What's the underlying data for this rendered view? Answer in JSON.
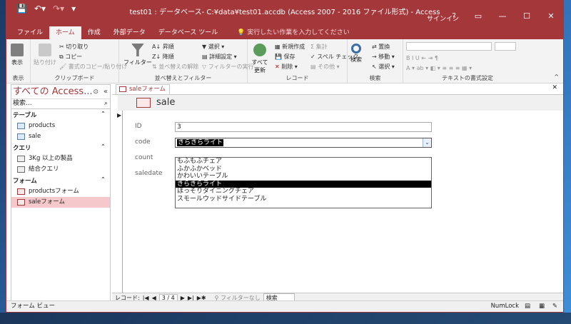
{
  "window": {
    "title": "test01 : データベース- C:¥data¥test01.accdb (Access 2007 - 2016 ファイル形式) - Access",
    "signin": "サインイン",
    "help": "?"
  },
  "tabs": [
    "ファイル",
    "ホーム",
    "作成",
    "外部データ",
    "データベース ツール"
  ],
  "tell_me": "実行したい作業を入力してください",
  "ribbon": {
    "view": "表示",
    "view_group": "表示",
    "paste": "貼り付け",
    "cut": "切り取り",
    "copy": "コピー",
    "format_painter": "書式のコピー/貼り付け",
    "clipboard_group": "クリップボード",
    "filter": "フィルター",
    "ascending": "昇順",
    "descending": "降順",
    "remove_sort": "並べ替えの解除",
    "selection": "選択",
    "advanced": "詳細設定",
    "toggle_filter": "フィルターの実行",
    "sort_filter_group": "並べ替えとフィルター",
    "refresh_all": "すべて更新",
    "new": "新規作成",
    "save": "保存",
    "delete": "削除",
    "totals": "集計",
    "spelling": "スペル チェック",
    "more": "その他",
    "records_group": "レコード",
    "find": "検索",
    "replace": "置換",
    "goto": "移動",
    "select": "選択",
    "find_group": "検索",
    "text_format_group": "テキストの書式設定"
  },
  "nav": {
    "header": "すべての Access...",
    "search_placeholder": "検索...",
    "sections": [
      {
        "title": "テーブル",
        "items": [
          "products",
          "sale"
        ]
      },
      {
        "title": "クエリ",
        "items": [
          "3Kg 以上の製品",
          "結合クエリ"
        ]
      },
      {
        "title": "フォーム",
        "items": [
          "productsフォーム",
          "saleフォーム"
        ]
      }
    ]
  },
  "document": {
    "tab_label": "saleフォーム",
    "form_title": "sale",
    "labels": {
      "id": "ID",
      "code": "code",
      "count": "count",
      "saledate": "saledate"
    },
    "id_value": "3",
    "code_value": "きらきらライト",
    "dropdown_options": [
      "もふもふチェア",
      "ふかふかベッド",
      "かわいいテーブル",
      "きらきらライト",
      "ほっそりダイニングチェア",
      "スモールウッドサイドテーブル"
    ],
    "dropdown_selected_index": 3
  },
  "record_nav": {
    "label": "レコード:",
    "position": "3 / 4",
    "filter": "フィルターなし",
    "search": "検索"
  },
  "status": {
    "left": "フォーム ビュー",
    "numlock": "NumLock"
  }
}
